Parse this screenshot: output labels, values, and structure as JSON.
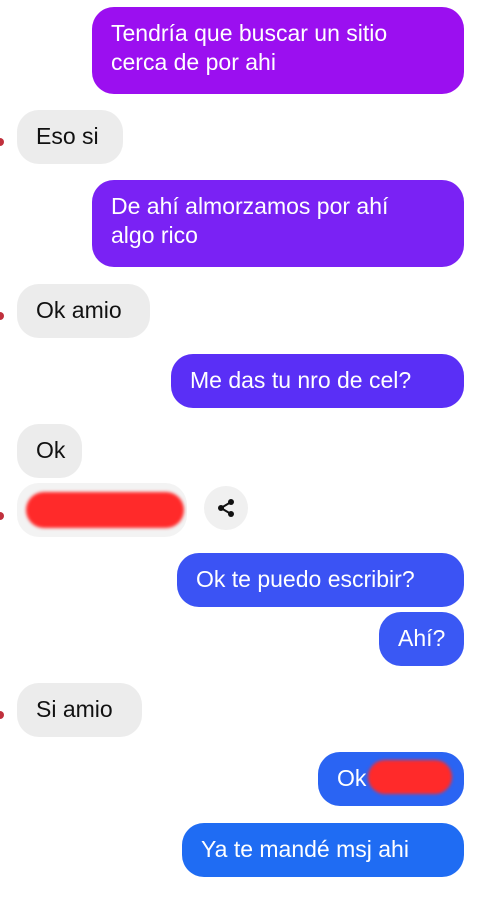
{
  "colors": {
    "sent_purple": "#9b0ff0",
    "sent_violet": "#7a22f4",
    "sent_indigo": "#5a2ff6",
    "sent_blue": "#3b53f4",
    "sent_lightblue": "#1f6cf3",
    "received_bg": "#ececec",
    "redaction": "#ff2a2a"
  },
  "messages": [
    {
      "side": "sent",
      "lines": [
        "Tendría que buscar un sitio",
        "cerca de por ahi"
      ]
    },
    {
      "side": "received",
      "text": "Eso si"
    },
    {
      "side": "sent",
      "lines": [
        "De ahí almorzamos por ahí",
        "algo rico"
      ]
    },
    {
      "side": "received",
      "text": "Ok amio"
    },
    {
      "side": "sent",
      "text": "Me das tu nro de cel?"
    },
    {
      "side": "received",
      "text": "Ok"
    },
    {
      "side": "received",
      "text": "",
      "redacted": true,
      "icon": "share-icon"
    },
    {
      "side": "sent",
      "text": "Ok te puedo escribir?"
    },
    {
      "side": "sent",
      "text": "Ahí?"
    },
    {
      "side": "received",
      "text": "Si amio"
    },
    {
      "side": "sent",
      "text": "Ok",
      "redacted": true
    },
    {
      "side": "sent",
      "text": "Ya te mandé msj ahi"
    }
  ]
}
